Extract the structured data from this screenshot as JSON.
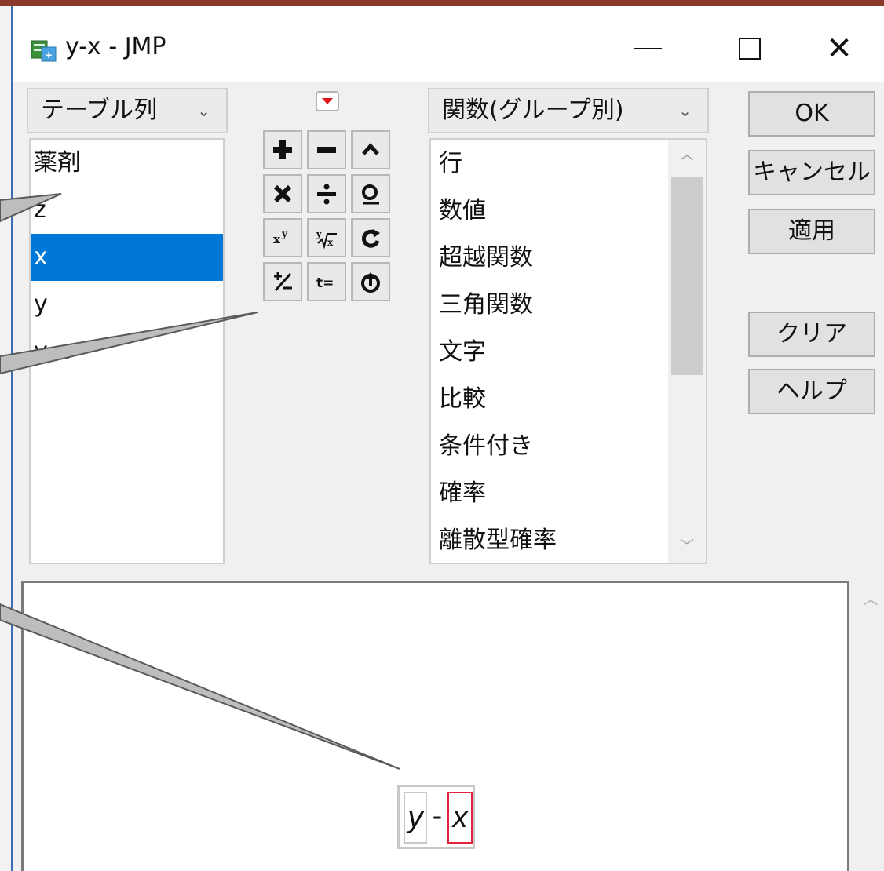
{
  "window": {
    "title": "y-x - JMP"
  },
  "left_panel": {
    "combo_label": "テーブル列",
    "columns": [
      {
        "label": "薬剤",
        "selected": false
      },
      {
        "label": "z",
        "selected": false
      },
      {
        "label": "x",
        "selected": true
      },
      {
        "label": "y",
        "selected": false
      },
      {
        "label": "y-x",
        "selected": false
      }
    ]
  },
  "keypad": {
    "rows": [
      [
        "add-icon",
        "subtract-icon",
        "power-caret-icon"
      ],
      [
        "multiply-icon",
        "divide-icon",
        "lookup-icon"
      ],
      [
        "x-power-y-icon",
        "root-icon",
        "swap-icon"
      ],
      [
        "plus-minus-icon",
        "assign-icon",
        "peel-icon"
      ]
    ]
  },
  "right_panel": {
    "combo_label": "関数(グループ別)",
    "functions": [
      "行",
      "数値",
      "超越関数",
      "三角関数",
      "文字",
      "比較",
      "条件付き",
      "確率",
      "離散型確率"
    ]
  },
  "buttons": {
    "ok": "OK",
    "cancel": "キャンセル",
    "apply": "適用",
    "clear": "クリア",
    "help": "ヘルプ"
  },
  "formula": {
    "left": "y",
    "operator": "-",
    "right": "x"
  },
  "colors": {
    "selection": "#0078d7",
    "accent_red": "#e0243b"
  }
}
